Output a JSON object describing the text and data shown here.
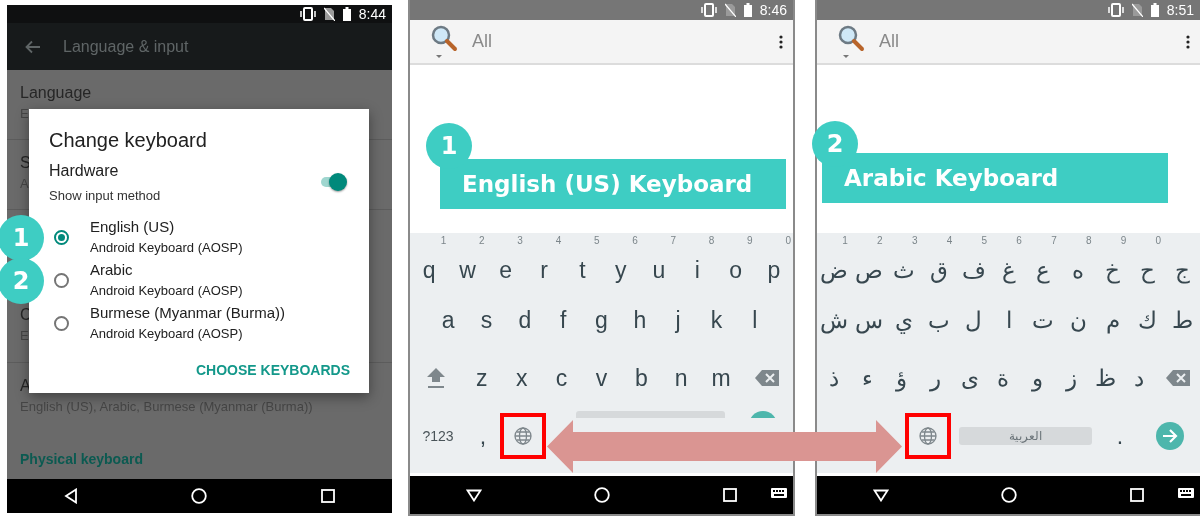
{
  "panels": [
    {
      "kind": "settings",
      "status_bar": {
        "time": "8:44"
      },
      "app_bar": {
        "title": "Language & input"
      },
      "list": [
        {
          "title": "Language",
          "summary": "E"
        },
        {
          "title": "S",
          "summary": "A"
        },
        {
          "title": "C",
          "summary": "E"
        },
        {
          "title": "A",
          "summary": "English (US), Arabic, Burmese (Myanmar (Burma))"
        }
      ],
      "category": "Physical keyboard",
      "dialog": {
        "title": "Change keyboard",
        "section": "Hardware",
        "toggle_label": "Show input method",
        "toggle_on": true,
        "options": [
          {
            "label": "English (US)",
            "detail": "Android Keyboard (AOSP)",
            "selected": true,
            "callout": "1"
          },
          {
            "label": "Arabic",
            "detail": "Android Keyboard (AOSP)",
            "selected": false,
            "callout": "2"
          },
          {
            "label": "Burmese (Myanmar (Burma))",
            "detail": "Android Keyboard (AOSP)",
            "selected": false
          }
        ],
        "action": "CHOOSE KEYBOARDS"
      }
    },
    {
      "kind": "keyboard",
      "status_bar": {
        "time": "8:46"
      },
      "search_bar": {
        "filter": "All"
      },
      "banner": {
        "number": "1",
        "label": "English (US) Keyboard"
      },
      "keyboard": {
        "hints": [
          "1",
          "2",
          "3",
          "4",
          "5",
          "6",
          "7",
          "8",
          "9",
          "0"
        ],
        "rows": [
          {
            "keys": [
              {
                "kind": "char",
                "label": "q"
              },
              {
                "kind": "char",
                "label": "w"
              },
              {
                "kind": "char",
                "label": "e"
              },
              {
                "kind": "char",
                "label": "r"
              },
              {
                "kind": "char",
                "label": "t"
              },
              {
                "kind": "char",
                "label": "y"
              },
              {
                "kind": "char",
                "label": "u"
              },
              {
                "kind": "char",
                "label": "i"
              },
              {
                "kind": "char",
                "label": "o"
              },
              {
                "kind": "char",
                "label": "p"
              }
            ]
          },
          {
            "keys": [
              {
                "kind": "char",
                "label": "a"
              },
              {
                "kind": "char",
                "label": "s"
              },
              {
                "kind": "char",
                "label": "d"
              },
              {
                "kind": "char",
                "label": "f"
              },
              {
                "kind": "char",
                "label": "g"
              },
              {
                "kind": "char",
                "label": "h"
              },
              {
                "kind": "char",
                "label": "j"
              },
              {
                "kind": "char",
                "label": "k"
              },
              {
                "kind": "char",
                "label": "l"
              }
            ]
          },
          {
            "keys": [
              {
                "kind": "shift"
              },
              {
                "kind": "char",
                "label": "z"
              },
              {
                "kind": "char",
                "label": "x"
              },
              {
                "kind": "char",
                "label": "c"
              },
              {
                "kind": "char",
                "label": "v"
              },
              {
                "kind": "char",
                "label": "b"
              },
              {
                "kind": "char",
                "label": "n"
              },
              {
                "kind": "char",
                "label": "m"
              },
              {
                "kind": "backspace"
              }
            ]
          },
          {
            "keys": [
              {
                "kind": "symbols",
                "label": "?123"
              },
              {
                "kind": "char",
                "label": ","
              },
              {
                "kind": "globe",
                "highlighted": true
              },
              {
                "kind": "space"
              },
              {
                "kind": "enter"
              }
            ]
          }
        ]
      }
    },
    {
      "kind": "keyboard",
      "status_bar": {
        "time": "8:51"
      },
      "search_bar": {
        "filter": "All"
      },
      "banner": {
        "number": "2",
        "label": "Arabic Keyboard"
      },
      "keyboard": {
        "hints": [
          "1",
          "2",
          "3",
          "4",
          "5",
          "6",
          "7",
          "8",
          "9",
          "0"
        ],
        "rows": [
          {
            "keys": [
              {
                "kind": "char",
                "label": "ج"
              },
              {
                "kind": "char",
                "label": "ح"
              },
              {
                "kind": "char",
                "label": "خ"
              },
              {
                "kind": "char",
                "label": "ه"
              },
              {
                "kind": "char",
                "label": "ع"
              },
              {
                "kind": "char",
                "label": "غ"
              },
              {
                "kind": "char",
                "label": "ف"
              },
              {
                "kind": "char",
                "label": "ق"
              },
              {
                "kind": "char",
                "label": "ث"
              },
              {
                "kind": "char",
                "label": "ص"
              },
              {
                "kind": "char",
                "label": "ض"
              }
            ]
          },
          {
            "keys": [
              {
                "kind": "char",
                "label": "ط"
              },
              {
                "kind": "char",
                "label": "ك"
              },
              {
                "kind": "char",
                "label": "م"
              },
              {
                "kind": "char",
                "label": "ن"
              },
              {
                "kind": "char",
                "label": "ت"
              },
              {
                "kind": "char",
                "label": "ا"
              },
              {
                "kind": "char",
                "label": "ل"
              },
              {
                "kind": "char",
                "label": "ب"
              },
              {
                "kind": "char",
                "label": "ي"
              },
              {
                "kind": "char",
                "label": "س"
              },
              {
                "kind": "char",
                "label": "ش"
              }
            ]
          },
          {
            "keys": [
              {
                "kind": "backspace"
              },
              {
                "kind": "char",
                "label": "د"
              },
              {
                "kind": "char",
                "label": "ظ"
              },
              {
                "kind": "char",
                "label": "ز"
              },
              {
                "kind": "char",
                "label": "و"
              },
              {
                "kind": "char",
                "label": "ة"
              },
              {
                "kind": "char",
                "label": "ى"
              },
              {
                "kind": "char",
                "label": "ر"
              },
              {
                "kind": "char",
                "label": "ؤ"
              },
              {
                "kind": "char",
                "label": "ء"
              },
              {
                "kind": "char",
                "label": "ذ"
              }
            ]
          },
          {
            "keys": [
              {
                "kind": "globe",
                "highlighted": true
              },
              {
                "kind": "space",
                "label": "العربية"
              },
              {
                "kind": "char",
                "label": "."
              },
              {
                "kind": "enter"
              }
            ]
          }
        ]
      }
    }
  ]
}
